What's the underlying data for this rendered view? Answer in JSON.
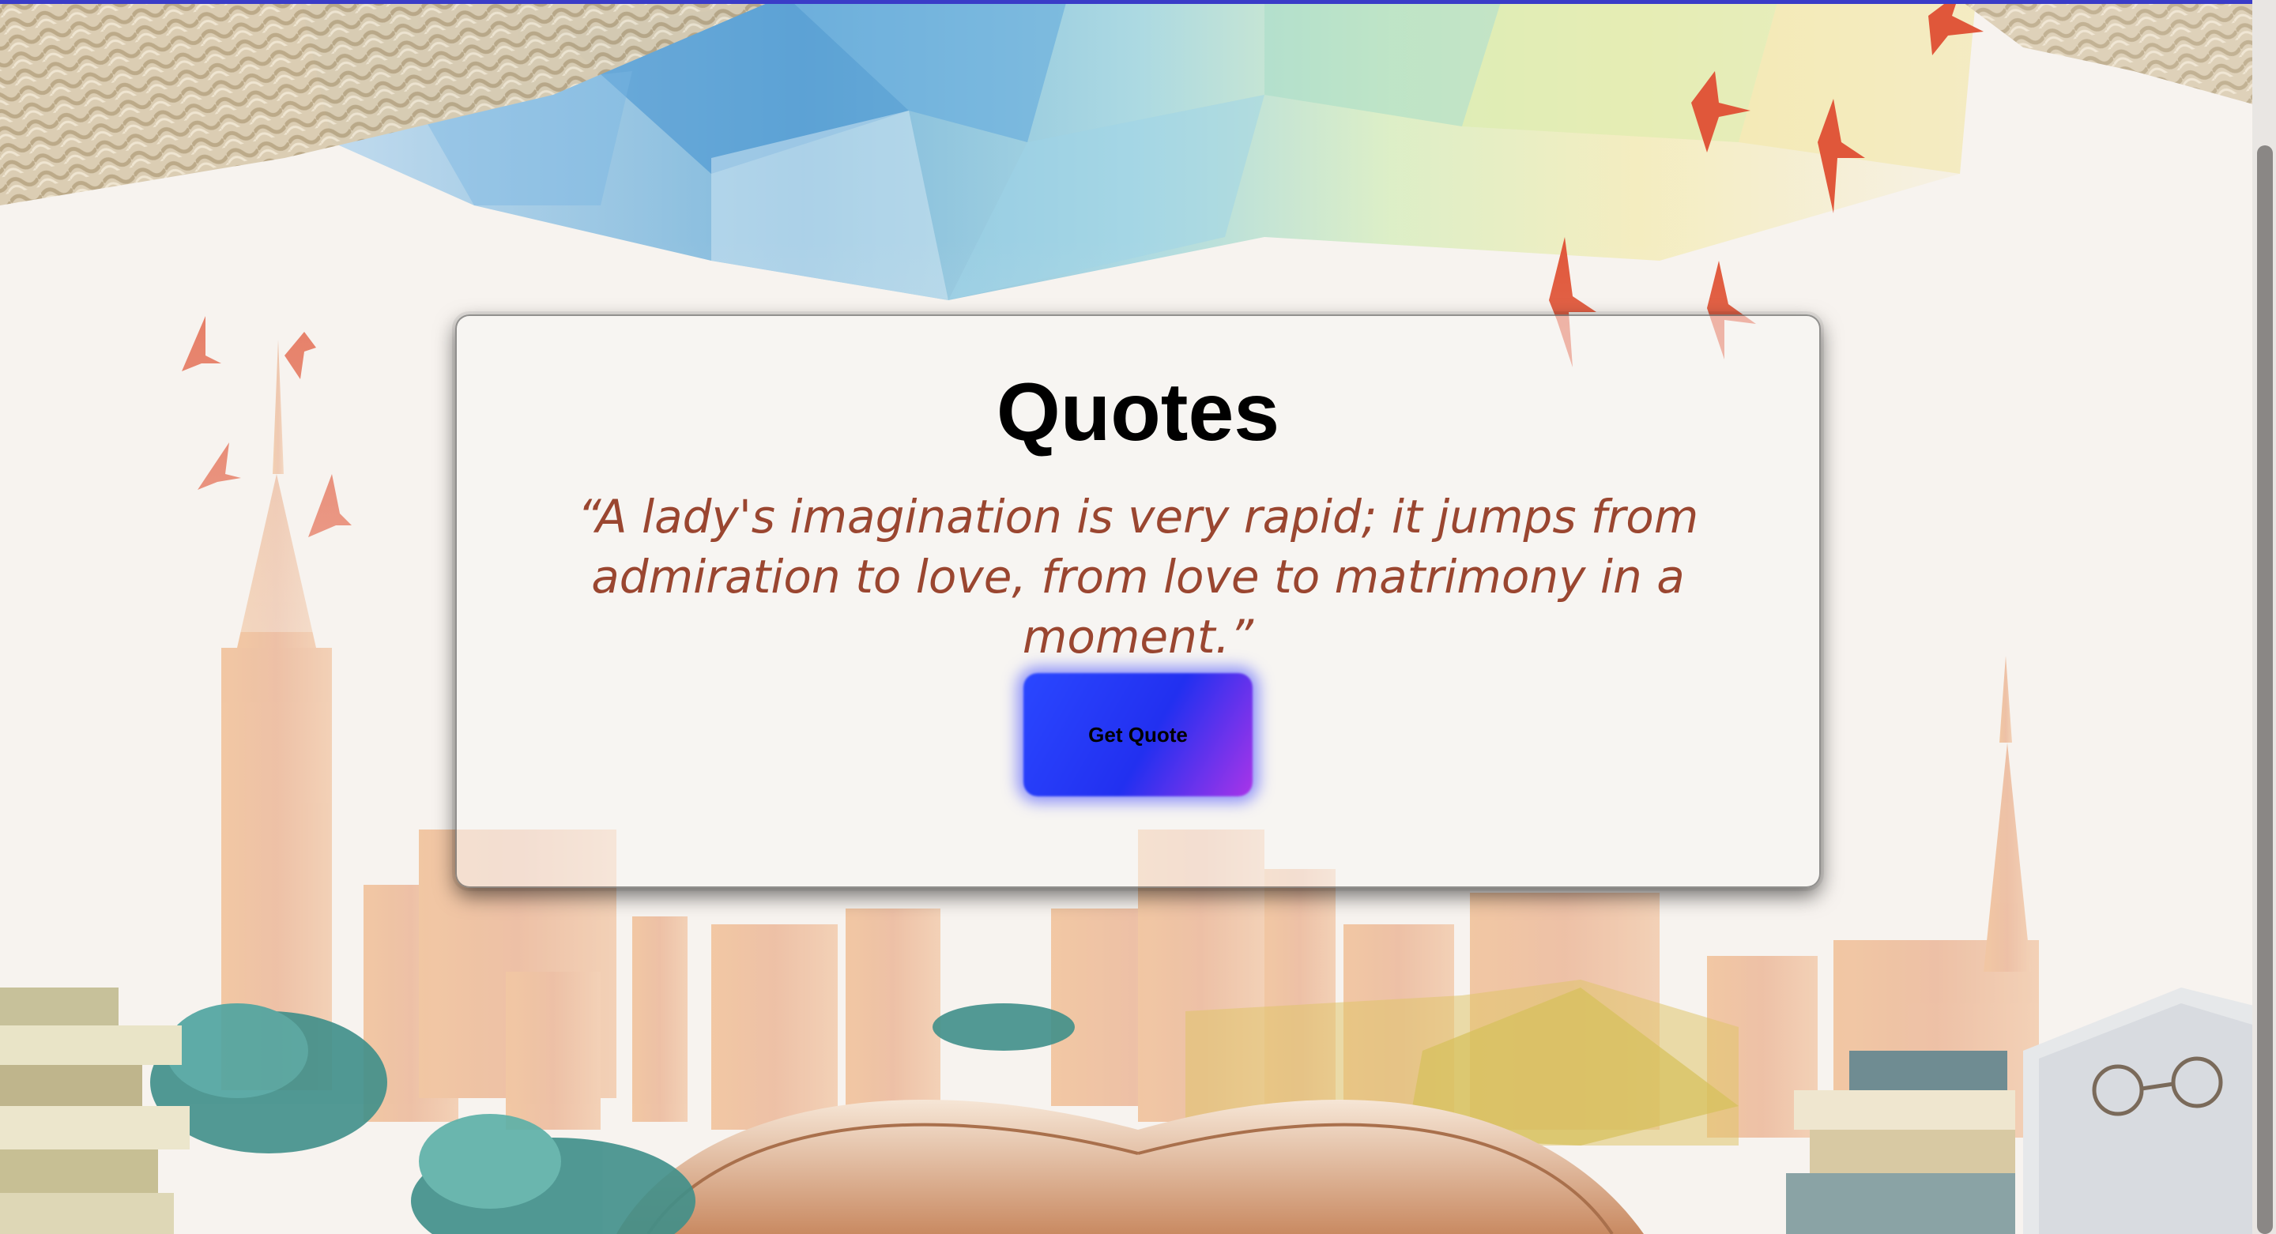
{
  "page": {
    "title": "Quotes",
    "quote_text": "“A lady's imagination is very rapid; it jumps from admiration to love, from love to matrimony in a moment.”",
    "button_label": "Get Quote"
  },
  "colors": {
    "accent_bar": "#3a3cc8",
    "quote_text": "#9a4630",
    "button_start": "#2a47ff",
    "button_end": "#a935e8"
  },
  "icons": {
    "background": "illustrated-books-city-background"
  }
}
